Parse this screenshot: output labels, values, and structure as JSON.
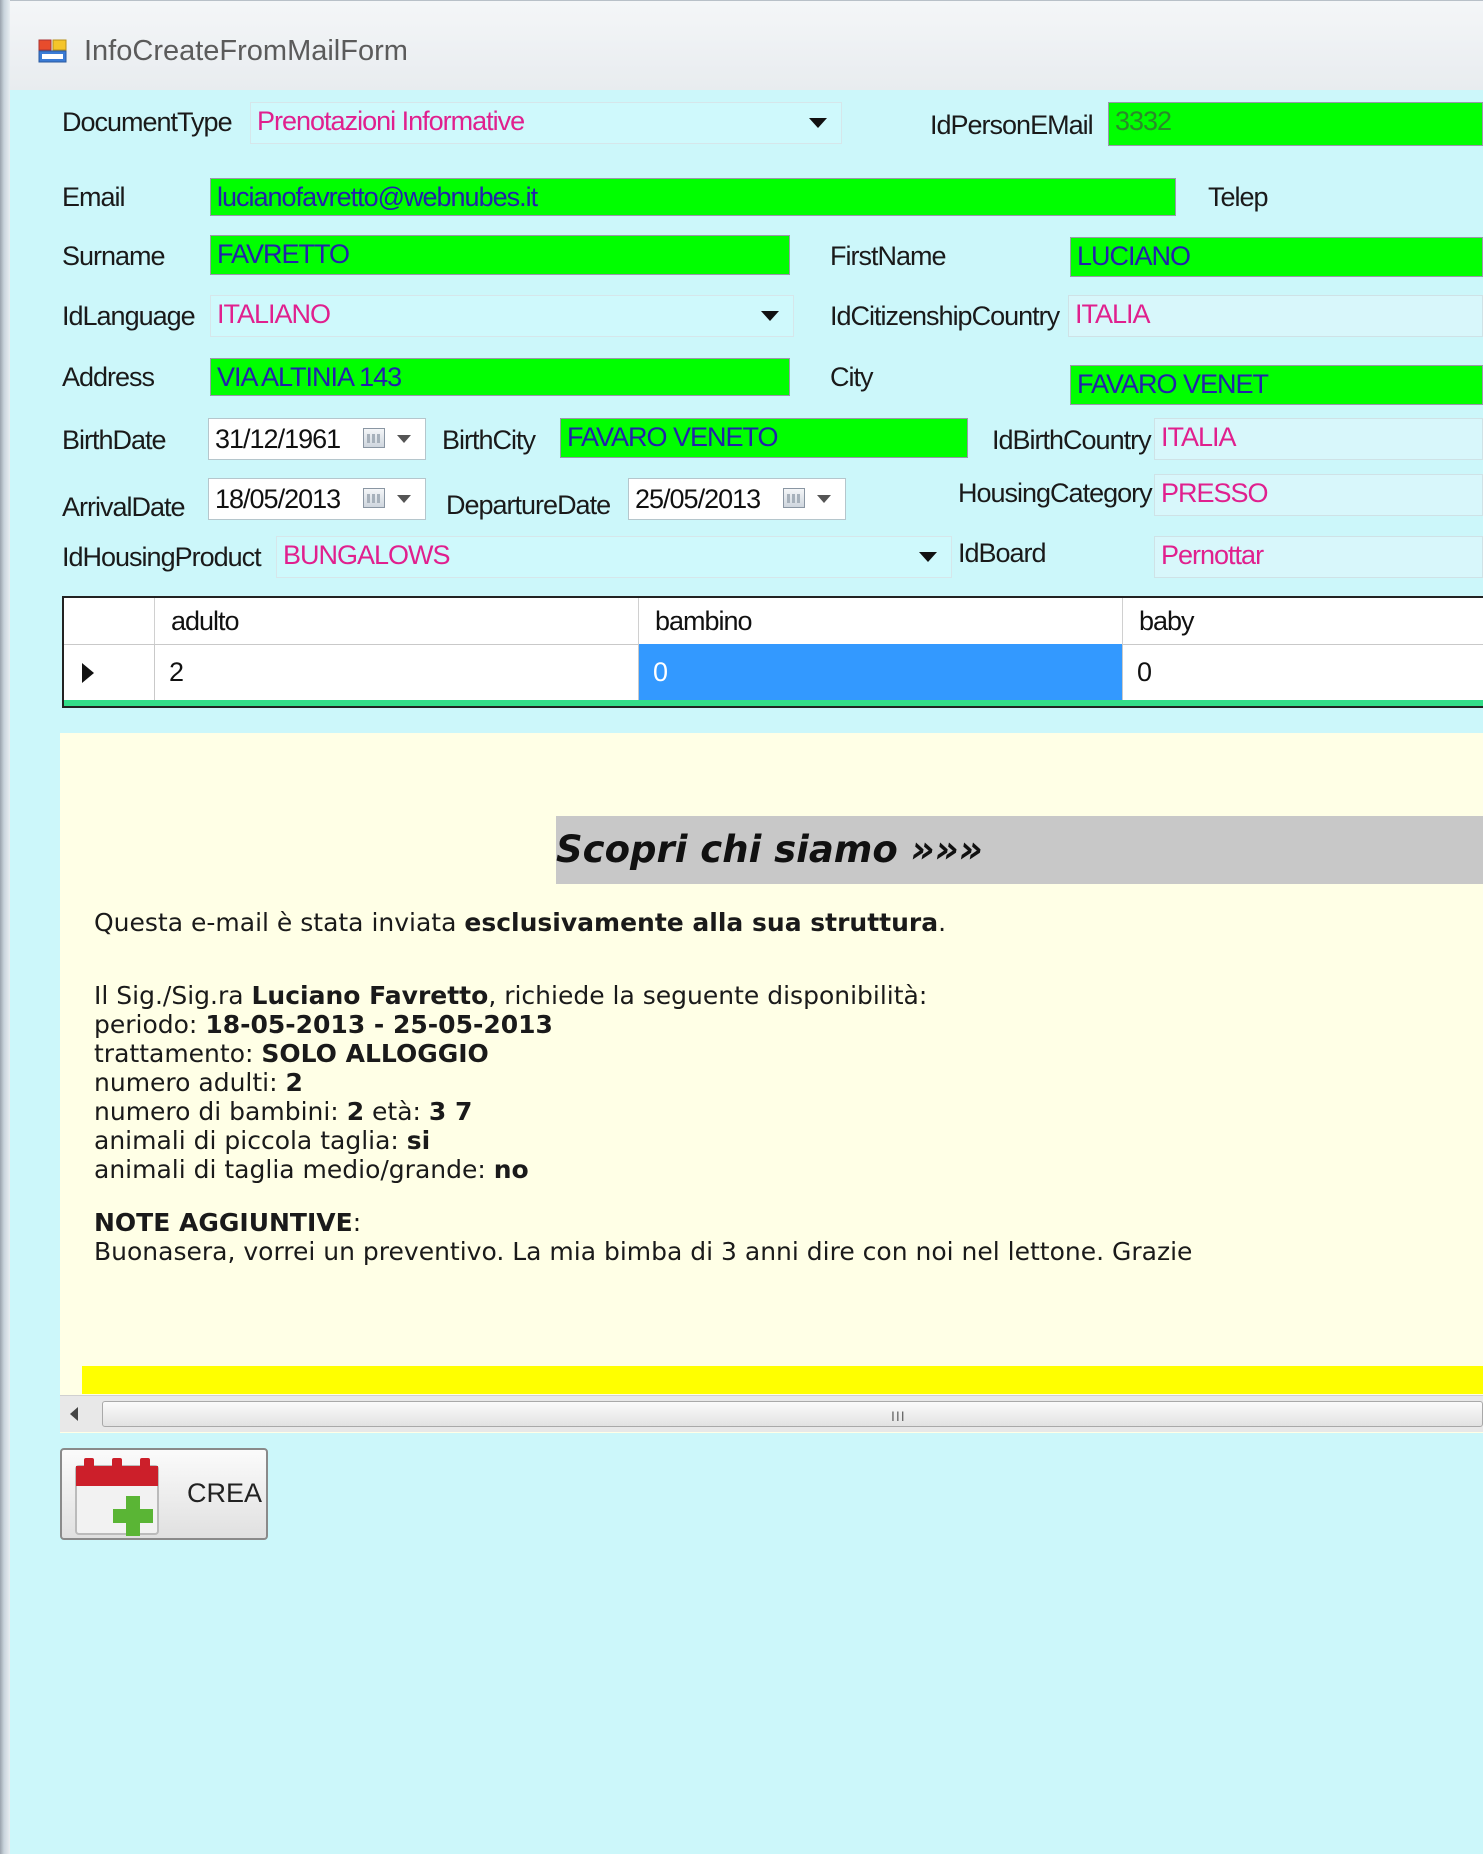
{
  "window": {
    "title": "InfoCreateFromMailForm"
  },
  "form": {
    "document_type": {
      "label": "DocumentType",
      "value": "Prenotazioni Informative"
    },
    "id_person_email": {
      "label": "IdPersonEMail",
      "value": "3332"
    },
    "email": {
      "label": "Email",
      "value": "lucianofavretto@webnubes.it"
    },
    "telephone": {
      "label": "Telep"
    },
    "surname": {
      "label": "Surname",
      "value": "FAVRETTO"
    },
    "first_name": {
      "label": "FirstName",
      "value": "LUCIANO"
    },
    "id_language": {
      "label": "IdLanguage",
      "value": "ITALIANO"
    },
    "id_citizenship_country": {
      "label": "IdCitizenshipCountry",
      "value": "ITALIA"
    },
    "address": {
      "label": "Address",
      "value": "VIA ALTINIA 143"
    },
    "city": {
      "label": "City",
      "value": "FAVARO VENET"
    },
    "birth_date": {
      "label": "BirthDate",
      "value": "31/12/1961"
    },
    "birth_city": {
      "label": "BirthCity",
      "value": "FAVARO VENETO"
    },
    "id_birth_country": {
      "label": "IdBirthCountry",
      "value": "ITALIA"
    },
    "arrival_date": {
      "label": "ArrivalDate",
      "value": "18/05/2013"
    },
    "departure_date": {
      "label": "DepartureDate",
      "value": "25/05/2013"
    },
    "housing_category": {
      "label": "HousingCategory",
      "value": "PRESSO"
    },
    "id_housing_product": {
      "label": "IdHousingProduct",
      "value": "BUNGALOWS"
    },
    "id_board": {
      "label": "IdBoard",
      "value": "Pernottar"
    }
  },
  "grid": {
    "columns": [
      "adulto",
      "bambino",
      "baby"
    ],
    "rows": [
      [
        "2",
        "0",
        "0"
      ]
    ]
  },
  "mail": {
    "banner": "Scopri chi siamo »»»",
    "line1_pre": "Questa e-mail è stata inviata ",
    "line1_bold": "esclusivamente alla sua struttura",
    "line1_post": ".",
    "req_pre": "Il Sig./Sig.ra ",
    "req_name": "Luciano Favretto",
    "req_post": ", richiede la seguente disponibilità:",
    "periodo_label": "periodo: ",
    "periodo_value": "18-05-2013 - 25-05-2013",
    "trattamento_label": "trattamento: ",
    "trattamento_value": "SOLO ALLOGGIO",
    "adulti_label": "numero adulti: ",
    "adulti_value": "2",
    "bambini_label": "numero di bambini: ",
    "bambini_value": "2",
    "eta_label": " età: ",
    "eta_value": "3 7",
    "piccola_label": "animali di piccola taglia: ",
    "piccola_value": "si",
    "grande_label": "animali di taglia medio/grande: ",
    "grande_value": "no",
    "note_label": "NOTE AGGIUNTIVE",
    "note_colon": ":",
    "note_text": "Buonasera, vorrei un preventivo. La mia bimba di 3 anni dire con noi nel lettone. Grazie"
  },
  "scrollbar": {
    "grip": "III"
  },
  "actions": {
    "crea_label": "CREA"
  },
  "colors": {
    "form_bg": "#ccf7fa",
    "filled_field": "#00ff00",
    "combo_text": "#e0208e",
    "selected_cell": "#3399ff",
    "mail_bg": "#ffffe6",
    "highlight_bar": "#ffff00"
  },
  "icons": {
    "title": "window-app-icon",
    "crea": "calendar-add-icon"
  }
}
